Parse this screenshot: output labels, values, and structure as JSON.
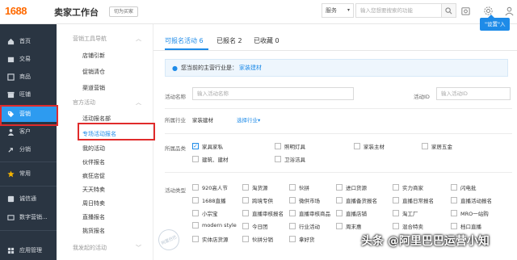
{
  "header": {
    "logo": "1688",
    "title": "卖家工作台",
    "switch_version": "切为买家",
    "service_select": "服务",
    "search_placeholder": "输入您想要搜索的功能",
    "settings_popup": "\"设置\"入"
  },
  "leftnav": {
    "items": [
      {
        "label": "首页",
        "icon": "home-icon"
      },
      {
        "label": "交易",
        "icon": "trade-icon"
      },
      {
        "label": "商品",
        "icon": "goods-icon"
      },
      {
        "label": "旺铺",
        "icon": "shop-icon"
      },
      {
        "label": "营销",
        "icon": "tag-icon",
        "active": true
      },
      {
        "label": "客户",
        "icon": "customer-icon"
      },
      {
        "label": "分销",
        "icon": "share-icon"
      },
      {
        "label": "常用",
        "icon": "star-icon"
      },
      {
        "label": "诚信通",
        "icon": "credit-icon"
      },
      {
        "label": "数字营销...",
        "icon": "digital-icon"
      },
      {
        "label": "应用管理",
        "icon": "apps-icon"
      }
    ]
  },
  "subnav": {
    "group1": "营销工具导航",
    "group1_items": [
      "店铺引新",
      "促销清仓",
      "渠道营销"
    ],
    "group2": "官方活动",
    "group2_items": [
      "活动报名部",
      "专场活动报名",
      "我的活动",
      "伙伴报名",
      "疯狂店促",
      "天天特卖",
      "周日特卖",
      "直播报名",
      "挑货报名"
    ],
    "group3": "我发起的活动"
  },
  "main": {
    "tabs": [
      {
        "label": "可报名活动 6"
      },
      {
        "label": "已报名 2"
      },
      {
        "label": "已收藏 0"
      }
    ],
    "notice_prefix": "您当前的主营行业是：",
    "notice_industry": "家装建材",
    "activity_name_label": "活动名称",
    "activity_name_placeholder": "输入活动名称",
    "activity_id_label": "活动ID",
    "activity_id_placeholder": "输入活动ID",
    "industry_label": "所属行业",
    "industry_value": "家装建材",
    "industry_select": "选择行业",
    "category_label": "所属品类",
    "categories": [
      {
        "label": "家具家私",
        "checked": true
      },
      {
        "label": "照明灯具",
        "checked": false
      },
      {
        "label": "家装主材",
        "checked": false
      },
      {
        "label": "家居五金",
        "checked": false
      },
      {
        "label": "建筑、建材",
        "checked": false
      },
      {
        "label": "卫浴洁具",
        "checked": false
      }
    ],
    "type_label": "活动类型",
    "types": [
      [
        "920高人节",
        "淘货源",
        "伙拼",
        "进口货源",
        "实力商家",
        "闪电批"
      ],
      [
        "1688直播",
        "跨境专供",
        "微供市场",
        "直播备货报名",
        "直播日常报名",
        "直播活动报名"
      ],
      [
        "小宗宝",
        "直播审核报名",
        "直播审核商品",
        "直播店铺",
        "淘工厂",
        "MRO一站购"
      ],
      [
        "modern style",
        "今日团",
        "行业活动",
        "周末惠",
        "混合特卖",
        "档口直播"
      ],
      [
        "实体店货源",
        "伙拼分销",
        "拿好货",
        "",
        "",
        ""
      ]
    ]
  },
  "watermark": "头条 @阿里巴巴运营小知",
  "stamp": "阿里巴巴"
}
